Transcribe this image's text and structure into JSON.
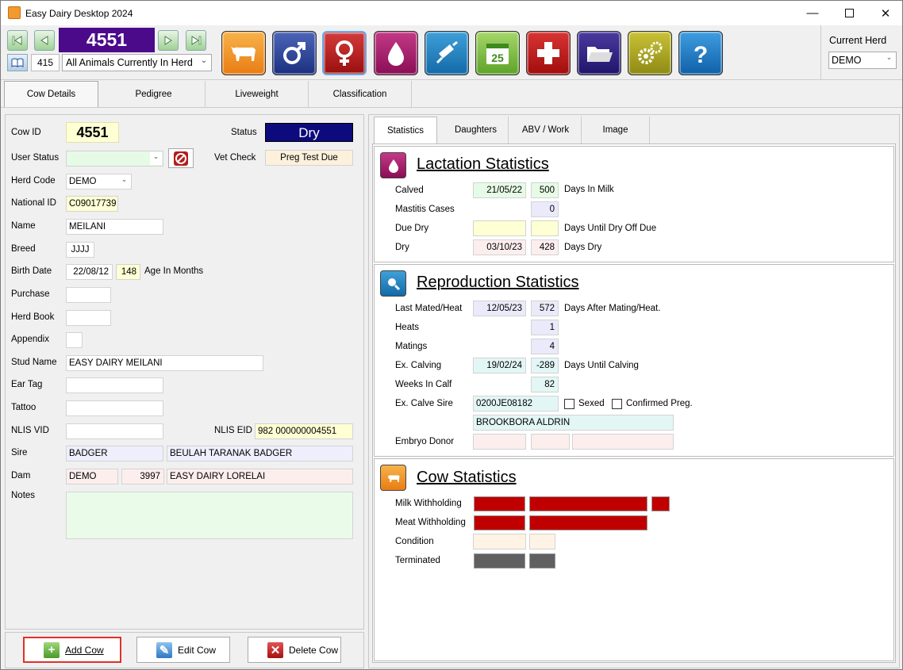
{
  "app": {
    "title": "Easy Dairy Desktop 2024"
  },
  "toolbar": {
    "cow_number": "4551",
    "animal_count": "415",
    "filter": "All Animals Currently In Herd",
    "current_herd_label": "Current Herd",
    "current_herd": "DEMO"
  },
  "main_tabs": [
    "Cow Details",
    "Pedigree",
    "Liveweight",
    "Classification"
  ],
  "cow": {
    "cow_id_label": "Cow ID",
    "cow_id": "4551",
    "status_label": "Status",
    "status": "Dry",
    "user_status_label": "User Status",
    "user_status": "",
    "vet_check_label": "Vet Check",
    "vet_check": "Preg Test Due",
    "herd_code_label": "Herd Code",
    "herd_code": "DEMO",
    "national_id_label": "National ID",
    "national_id": "C09017739",
    "name_label": "Name",
    "name": "MEILANI",
    "breed_label": "Breed",
    "breed": "JJJJ",
    "birth_date_label": "Birth Date",
    "birth_date": "22/08/12",
    "age_months": "148",
    "age_label": "Age In Months",
    "purchase_label": "Purchase",
    "purchase": "",
    "herd_book_label": "Herd Book",
    "herd_book": "",
    "appendix_label": "Appendix",
    "appendix": "",
    "stud_name_label": "Stud Name",
    "stud_name": "EASY DAIRY  MEILANI",
    "ear_tag_label": "Ear Tag",
    "ear_tag": "",
    "tattoo_label": "Tattoo",
    "tattoo": "",
    "nlis_vid_label": "NLIS VID",
    "nlis_vid": "",
    "nlis_eid_label": "NLIS EID",
    "nlis_eid": "982 000000004551",
    "sire_label": "Sire",
    "sire_code": "BADGER",
    "sire_name": "BEULAH TARANAK BADGER",
    "dam_label": "Dam",
    "dam_herd": "DEMO",
    "dam_id": "3997",
    "dam_name": "EASY DAIRY  LORELAI",
    "notes_label": "Notes",
    "notes": ""
  },
  "buttons": {
    "add": "Add Cow",
    "edit": "Edit Cow",
    "delete": "Delete Cow"
  },
  "right_tabs": [
    "Statistics",
    "Daughters",
    "ABV / Work",
    "Image"
  ],
  "lactation": {
    "title": "Lactation Statistics",
    "calved_label": "Calved",
    "calved": "21/05/22",
    "days_in_milk": "500",
    "days_in_milk_label": "Days In Milk",
    "mastitis_label": "Mastitis Cases",
    "mastitis": "0",
    "due_dry_label": "Due Dry",
    "due_dry": "",
    "days_until_dry": "",
    "days_until_dry_label": "Days Until Dry Off Due",
    "dry_label": "Dry",
    "dry": "03/10/23",
    "days_dry": "428",
    "days_dry_label": "Days Dry"
  },
  "reproduction": {
    "title": "Reproduction Statistics",
    "last_mated_label": "Last Mated/Heat",
    "last_mated": "12/05/23",
    "days_after": "572",
    "days_after_label": "Days After Mating/Heat.",
    "heats_label": "Heats",
    "heats": "1",
    "matings_label": "Matings",
    "matings": "4",
    "ex_calving_label": "Ex. Calving",
    "ex_calving": "19/02/24",
    "days_until_calving": "-289",
    "days_until_calving_label": "Days Until Calving",
    "weeks_in_calf_label": "Weeks In Calf",
    "weeks_in_calf": "82",
    "ex_calve_sire_label": "Ex. Calve Sire",
    "ex_calve_sire": "0200JE08182",
    "sexed_label": "Sexed",
    "confirmed_label": "Confirmed Preg.",
    "ex_calve_sire_name": "BROOKBORA ALDRIN",
    "embryo_donor_label": "Embryo Donor"
  },
  "cow_stats": {
    "title": "Cow Statistics",
    "milk_withholding_label": "Milk Withholding",
    "meat_withholding_label": "Meat Withholding",
    "condition_label": "Condition",
    "terminated_label": "Terminated"
  },
  "colors": {
    "status_bg": "#0c0a7c",
    "cow_number_bg": "#4b0a8a",
    "withholding": "#c00000",
    "terminated": "#606060"
  }
}
